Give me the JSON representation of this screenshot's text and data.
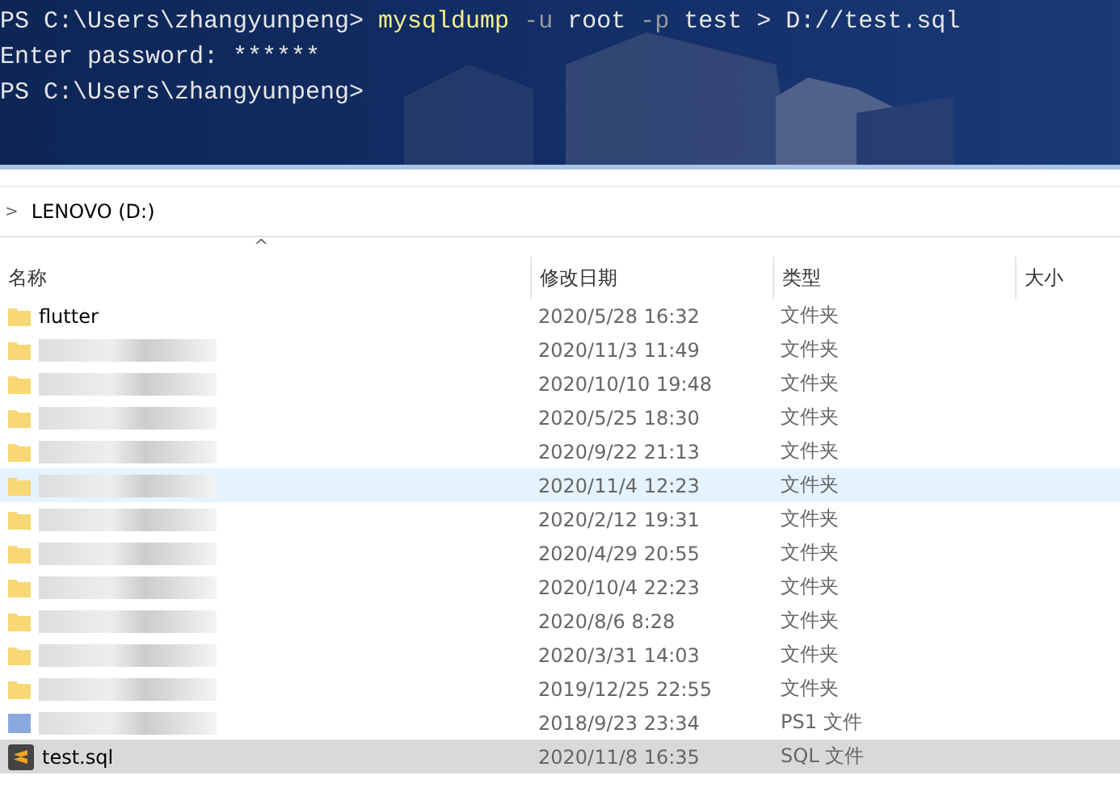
{
  "terminal": {
    "lines": [
      [
        {
          "kind": "prompt",
          "text": "PS C:\\Users\\zhangyunpeng> "
        },
        {
          "kind": "command",
          "text": "mysqldump"
        },
        {
          "kind": "param",
          "text": " -u"
        },
        {
          "kind": "arg",
          "text": " root"
        },
        {
          "kind": "param",
          "text": " -p"
        },
        {
          "kind": "arg",
          "text": " test > D://test.sql"
        }
      ],
      [
        {
          "kind": "prompt",
          "text": "Enter password: ******"
        }
      ],
      [
        {
          "kind": "prompt",
          "text": "PS C:\\Users\\zhangyunpeng>"
        }
      ]
    ]
  },
  "breadcrumb": {
    "chevron": ">",
    "label": "LENOVO (D:)"
  },
  "table": {
    "sort_caret": "^",
    "columns": [
      "名称",
      "修改日期",
      "类型",
      "大小"
    ],
    "rows": [
      {
        "kind": "folder",
        "name": "flutter",
        "date": "2020/5/28 16:32",
        "type": "文件夹",
        "hovered": false,
        "selected": false
      },
      {
        "kind": "folder",
        "date": "2020/11/3 11:49",
        "type": "文件夹",
        "hovered": false,
        "selected": false
      },
      {
        "kind": "folder",
        "date": "2020/10/10 19:48",
        "type": "文件夹",
        "hovered": false,
        "selected": false
      },
      {
        "kind": "folder",
        "date": "2020/5/25 18:30",
        "type": "文件夹",
        "hovered": false,
        "selected": false
      },
      {
        "kind": "folder",
        "date": "2020/9/22 21:13",
        "type": "文件夹",
        "hovered": false,
        "selected": false
      },
      {
        "kind": "folder",
        "date": "2020/11/4 12:23",
        "type": "文件夹",
        "hovered": true,
        "selected": false
      },
      {
        "kind": "folder",
        "date": "2020/2/12 19:31",
        "type": "文件夹",
        "hovered": false,
        "selected": false
      },
      {
        "kind": "folder",
        "date": "2020/4/29 20:55",
        "type": "文件夹",
        "hovered": false,
        "selected": false
      },
      {
        "kind": "folder",
        "date": "2020/10/4 22:23",
        "type": "文件夹",
        "hovered": false,
        "selected": false
      },
      {
        "kind": "folder",
        "date": "2020/8/6 8:28",
        "type": "文件夹",
        "hovered": false,
        "selected": false
      },
      {
        "kind": "folder",
        "date": "2020/3/31 14:03",
        "type": "文件夹",
        "hovered": false,
        "selected": false
      },
      {
        "kind": "folder",
        "date": "2019/12/25 22:55",
        "type": "文件夹",
        "hovered": false,
        "selected": false
      },
      {
        "kind": "script",
        "date": "2018/9/23 23:34",
        "type": "PS1 文件",
        "hovered": false,
        "selected": false
      },
      {
        "kind": "sql",
        "name": "test.sql",
        "date": "2020/11/8 16:35",
        "type": "SQL 文件",
        "hovered": false,
        "selected": true
      }
    ]
  }
}
